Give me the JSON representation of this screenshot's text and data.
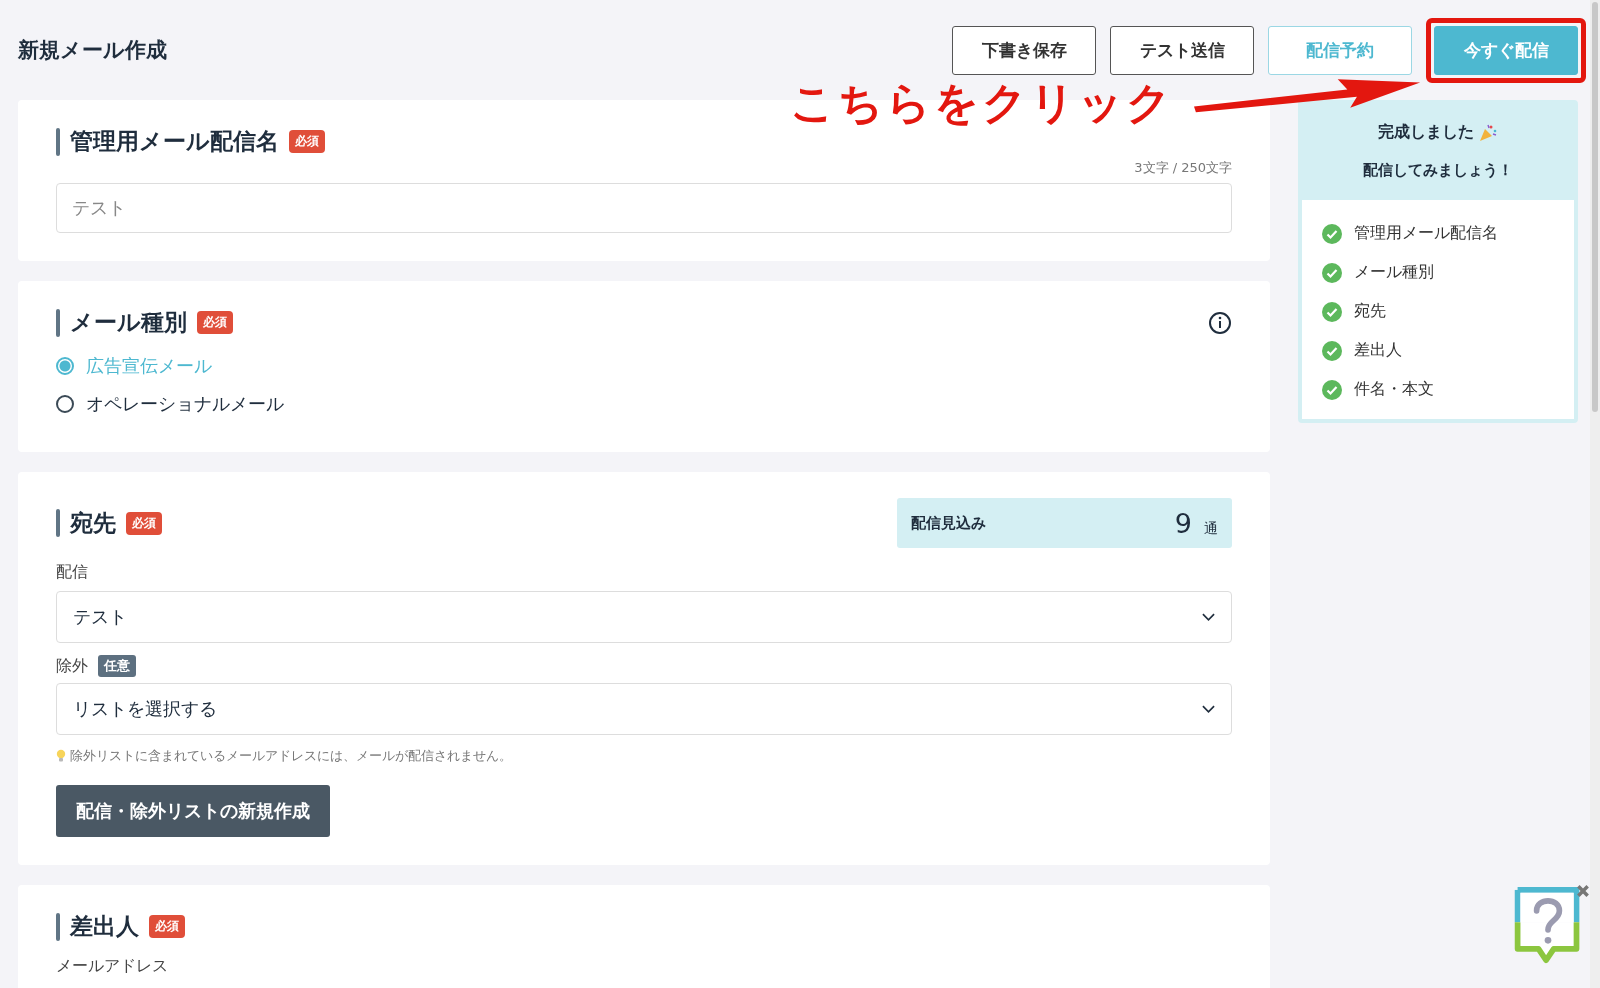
{
  "page": {
    "title": "新規メール作成"
  },
  "actions": [
    {
      "label": "下書き保存",
      "kind": "outline",
      "highlighted": false
    },
    {
      "label": "テスト送信",
      "kind": "outline",
      "highlighted": false
    },
    {
      "label": "配信予約",
      "kind": "accent",
      "highlighted": false
    },
    {
      "label": "今すぐ配信",
      "kind": "primary",
      "highlighted": true
    }
  ],
  "annotation": {
    "text": "こちらをクリック"
  },
  "name_section": {
    "title": "管理用メール配信名",
    "badge": "必須",
    "counter": "3文字 / 250文字",
    "value": "テスト"
  },
  "type_section": {
    "title": "メール種別",
    "badge": "必須",
    "options": [
      {
        "label": "広告宣伝メール",
        "selected": true
      },
      {
        "label": "オペレーショナルメール",
        "selected": false
      }
    ]
  },
  "recipients_section": {
    "title": "宛先",
    "badge": "必須",
    "estimate": {
      "label": "配信見込み",
      "count": "9",
      "unit": "通"
    },
    "delivery_label": "配信",
    "delivery_value": "テスト",
    "exclude_label": "除外",
    "exclude_badge": "任意",
    "exclude_value": "リストを選択する",
    "hint": "除外リストに含まれているメールアドレスには、メールが配信されません。",
    "create_button": "配信・除外リストの新規作成"
  },
  "sender_section": {
    "title": "差出人",
    "badge": "必須",
    "email_label": "メールアドレス"
  },
  "progress": {
    "title": "完成しました",
    "subtitle": "配信してみましょう！",
    "items": [
      {
        "label": "管理用メール配信名",
        "done": true
      },
      {
        "label": "メール種別",
        "done": true
      },
      {
        "label": "宛先",
        "done": true
      },
      {
        "label": "差出人",
        "done": true
      },
      {
        "label": "件名・本文",
        "done": true
      }
    ]
  }
}
